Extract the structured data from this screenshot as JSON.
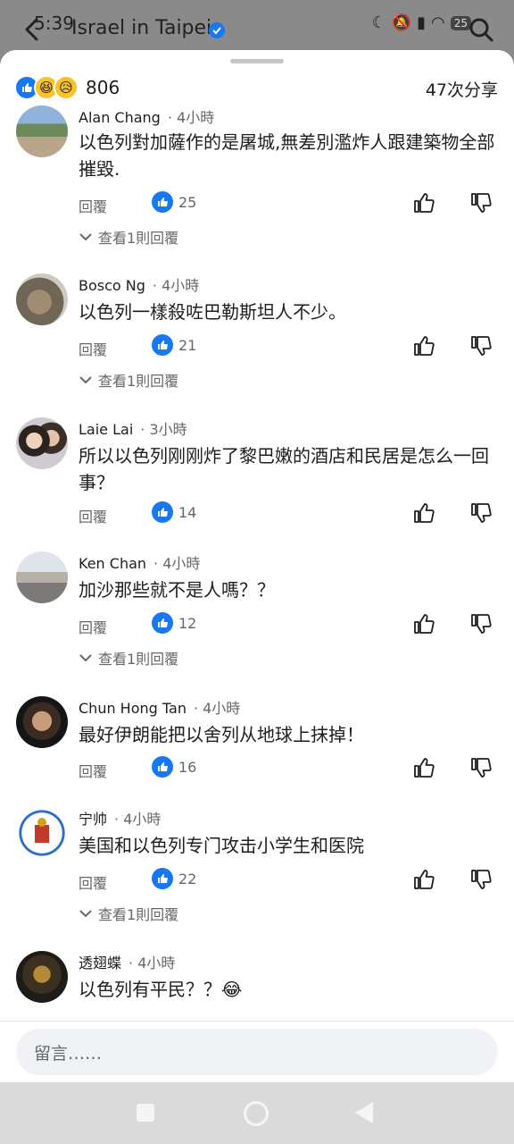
{
  "status_bar": {
    "time": "5:39",
    "battery": "25"
  },
  "page": {
    "title": "Israel in Taipei"
  },
  "reactions": {
    "count": "806",
    "types": [
      "like-icon",
      "haha-icon",
      "sad-icon"
    ]
  },
  "shares": "47次分享",
  "labels": {
    "reply": "回覆",
    "view_one_reply": "查看1則回覆"
  },
  "comments": [
    {
      "name": "Alan Chang",
      "time": "4小時",
      "text": "以色列對加薩作的是屠城,無差別濫炸人跟建築物全部摧毀.",
      "likes": "25",
      "has_replies": true
    },
    {
      "name": "Bosco Ng",
      "time": "4小時",
      "text": "以色列一樣殺咗巴勒斯坦人不少。",
      "likes": "21",
      "has_replies": true
    },
    {
      "name": "Laie Lai",
      "time": "3小時",
      "text": "所以以色列刚刚炸了黎巴嫩的酒店和民居是怎么一回事？",
      "likes": "14",
      "has_replies": false
    },
    {
      "name": "Ken Chan",
      "time": "4小時",
      "text": "加沙那些就不是人嗎？？",
      "likes": "12",
      "has_replies": true
    },
    {
      "name": "Chun Hong Tan",
      "time": "4小時",
      "text": "最好伊朗能把以舍列从地球上抹掉！",
      "likes": "16",
      "has_replies": false
    },
    {
      "name": "宁帅",
      "time": "4小時",
      "text": "美国和以色列专门攻击小学生和医院",
      "likes": "22",
      "has_replies": true
    },
    {
      "name": "透翅蝶",
      "time": "4小時",
      "text": "以色列有平民？？😂",
      "likes": "",
      "has_replies": false
    }
  ],
  "composer": {
    "placeholder": "留言……"
  },
  "colors": {
    "accent": "#1877f2",
    "muted": "#65676b"
  }
}
